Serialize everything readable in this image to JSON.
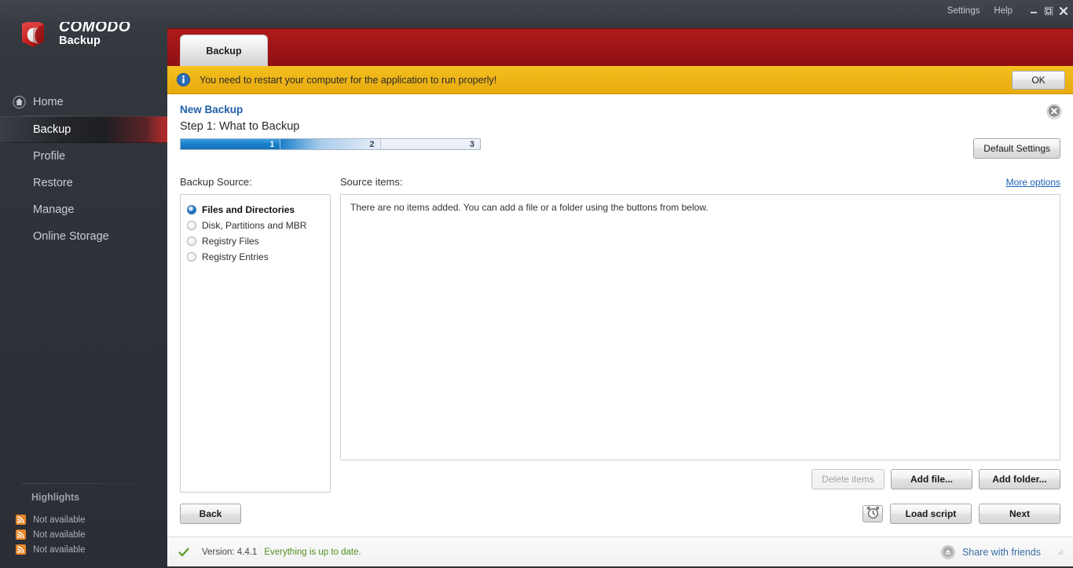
{
  "titlebar": {
    "settings": "Settings",
    "help": "Help",
    "minimize_icon": "minimize-icon",
    "maximize_icon": "maximize-icon",
    "close_icon": "close-icon"
  },
  "brand": {
    "name": "COMODO",
    "product": "Backup",
    "logo_icon": "comodo-logo-icon"
  },
  "sidebar": {
    "items": [
      {
        "label": "Home",
        "icon": "home-icon",
        "selected": false
      },
      {
        "label": "Backup",
        "icon": "",
        "selected": true
      },
      {
        "label": "Profile",
        "icon": "",
        "selected": false
      },
      {
        "label": "Restore",
        "icon": "",
        "selected": false
      },
      {
        "label": "Manage",
        "icon": "",
        "selected": false
      },
      {
        "label": "Online Storage",
        "icon": "",
        "selected": false
      }
    ],
    "highlights": {
      "title": "Highlights",
      "rows": [
        {
          "label": "Not available",
          "icon": "rss-icon"
        },
        {
          "label": "Not available",
          "icon": "rss-icon"
        },
        {
          "label": "Not available",
          "icon": "rss-icon"
        }
      ]
    }
  },
  "tabs": [
    {
      "label": "Backup",
      "active": true
    }
  ],
  "notice": {
    "icon": "info-icon",
    "text": "You need to restart your computer for the application to run properly!",
    "ok_label": "OK"
  },
  "wizard": {
    "title": "New Backup",
    "step_text": "Step 1: What to Backup",
    "close_icon": "close-circle-icon",
    "default_settings_label": "Default Settings",
    "steps": [
      {
        "number": "1",
        "state": "active"
      },
      {
        "number": "2",
        "state": "next"
      },
      {
        "number": "3",
        "state": "pending"
      }
    ]
  },
  "backup_source": {
    "label": "Backup Source:",
    "options": [
      {
        "label": "Files and Directories",
        "selected": true
      },
      {
        "label": "Disk, Partitions and MBR",
        "selected": false
      },
      {
        "label": "Registry Files",
        "selected": false
      },
      {
        "label": "Registry Entries",
        "selected": false
      }
    ]
  },
  "source_items": {
    "label": "Source items:",
    "more_options_label": "More options",
    "empty_message": "There are no items added. You can add a file or a folder using the buttons from below.",
    "actions": [
      {
        "label": "Delete items",
        "disabled": true
      },
      {
        "label": "Add file...",
        "disabled": false
      },
      {
        "label": "Add folder...",
        "disabled": false
      }
    ]
  },
  "footer": {
    "back_label": "Back",
    "schedule_icon": "alarm-clock-icon",
    "load_script_label": "Load script",
    "next_label": "Next"
  },
  "statusbar": {
    "check_icon": "check-icon",
    "version_label": "Version: 4.4.1",
    "update_status": "Everything is up to date.",
    "share_icon": "share-arrow-icon",
    "share_label": "Share with friends"
  },
  "colors": {
    "brand_red": "#9d1416",
    "notice_yellow": "#edb417",
    "accent_blue": "#1a7fc9",
    "link_blue": "#1a62b5",
    "status_green": "#4f8f22",
    "sidebar_dark": "#2e3239"
  }
}
